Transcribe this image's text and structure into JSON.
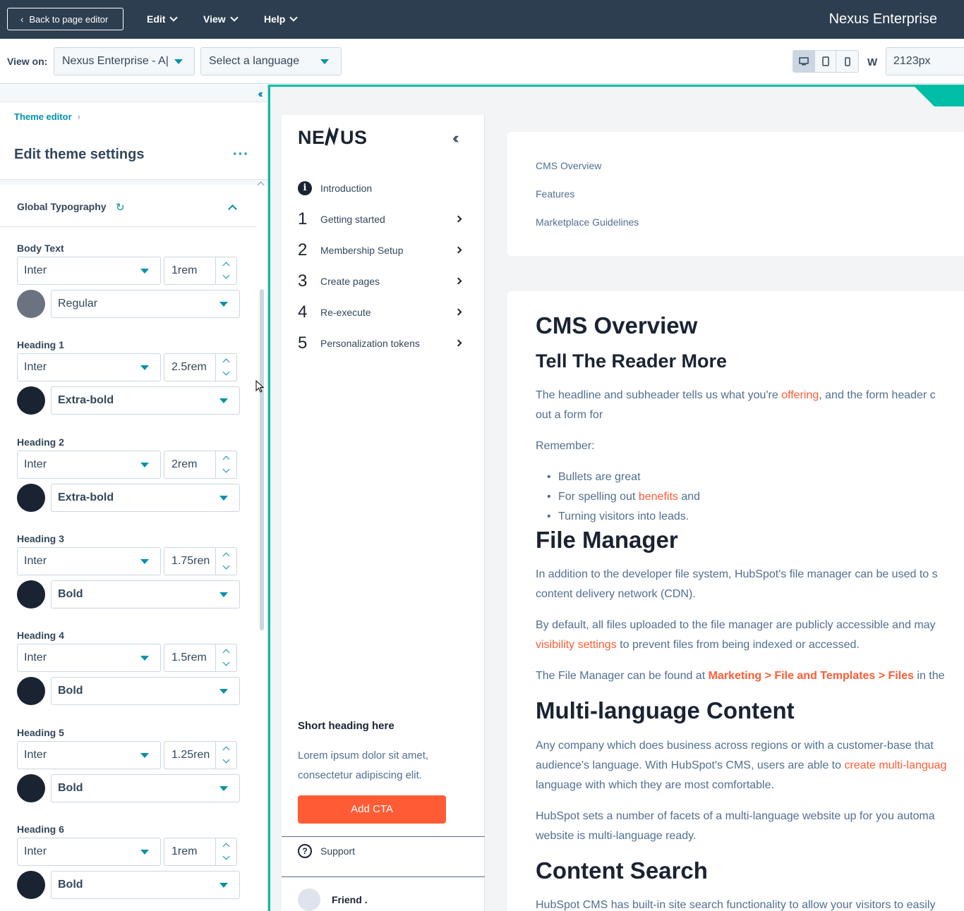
{
  "topbar": {
    "back_label": "Back to page editor",
    "menu": [
      "Edit",
      "View",
      "Help"
    ],
    "title": "Nexus Enterprise"
  },
  "viewbar": {
    "view_on_label": "View on:",
    "page_select": "Nexus Enterprise - A|",
    "language_select": "Select a language",
    "width_label": "W",
    "width_value": "2123px"
  },
  "panel": {
    "breadcrumb": "Theme editor",
    "title": "Edit theme settings",
    "more": "···",
    "section_title": "Global Typography",
    "groups": [
      {
        "label": "Body Text",
        "font": "Inter",
        "size": "1rem",
        "color": "#6b7280",
        "weight": "Regular"
      },
      {
        "label": "Heading 1",
        "font": "Inter",
        "size": "2.5rem",
        "color": "#1a2332",
        "weight": "Extra-bold"
      },
      {
        "label": "Heading 2",
        "font": "Inter",
        "size": "2rem",
        "color": "#1a2332",
        "weight": "Extra-bold"
      },
      {
        "label": "Heading 3",
        "font": "Inter",
        "size": "1.75ren",
        "color": "#1a2332",
        "weight": "Bold"
      },
      {
        "label": "Heading 4",
        "font": "Inter",
        "size": "1.5rem",
        "color": "#1a2332",
        "weight": "Bold"
      },
      {
        "label": "Heading 5",
        "font": "Inter",
        "size": "1.25ren",
        "color": "#1a2332",
        "weight": "Bold"
      },
      {
        "label": "Heading 6",
        "font": "Inter",
        "size": "1rem",
        "color": "#1a2332",
        "weight": "Bold"
      }
    ]
  },
  "preview": {
    "logo": "NEXUS",
    "nav": [
      {
        "num": "",
        "label": "Introduction",
        "icon": "info-icon"
      },
      {
        "num": "1",
        "label": "Getting started"
      },
      {
        "num": "2",
        "label": "Membership Setup"
      },
      {
        "num": "3",
        "label": "Create pages"
      },
      {
        "num": "4",
        "label": "Re-execute"
      },
      {
        "num": "5",
        "label": "Personalization tokens"
      }
    ],
    "short_heading": "Short heading here",
    "lorem": "Lorem ipsum dolor sit amet, consectetur adipiscing elit.",
    "cta": "Add CTA",
    "support": "Support",
    "user": "Friend .",
    "toc": [
      "CMS Overview",
      "Features",
      "Marketplace Guidelines"
    ],
    "content": {
      "h1": "CMS Overview",
      "h2_reader": "Tell The Reader More",
      "p1_a": "The headline and subheader tells us what you're ",
      "p1_link": "offering",
      "p1_b": ", and the form header c",
      "p1_line2": "out a form for",
      "remember": "Remember:",
      "bullet1": "Bullets are great",
      "bullet2_a": "For spelling out ",
      "bullet2_link": "benefits",
      "bullet2_b": " and",
      "bullet3": "Turning visitors into leads.",
      "h_file": "File Manager",
      "fm1_line1": "In addition to the developer file system, HubSpot's file manager can be used to s",
      "fm1_line2": "content delivery network (CDN).",
      "fm2_line1": "By default, all files uploaded to the file manager are publicly accessible and may",
      "fm2_link": "visibility settings",
      "fm2_line2_rest": " to prevent files from being indexed or accessed.",
      "fm3_a": "The File Manager can be found at ",
      "fm3_link": "Marketing > File and Templates > Files",
      "fm3_b": " in the",
      "h_multi": "Multi-language Content",
      "ml1_line1": "Any company which does business across regions or with a customer-base that",
      "ml1_line2_a": "audience's language. With HubSpot's CMS, users are able to ",
      "ml1_link": "create multi-languag",
      "ml1_line3": "language with which they are most comfortable.",
      "ml2_line1": "HubSpot sets a number of facets of a multi-language website up for you automa",
      "ml2_line2": "website is multi-language ready.",
      "h_search": "Content Search",
      "cs_line1": "HubSpot CMS has built-in site search functionality to allow your visitors to easily"
    }
  }
}
